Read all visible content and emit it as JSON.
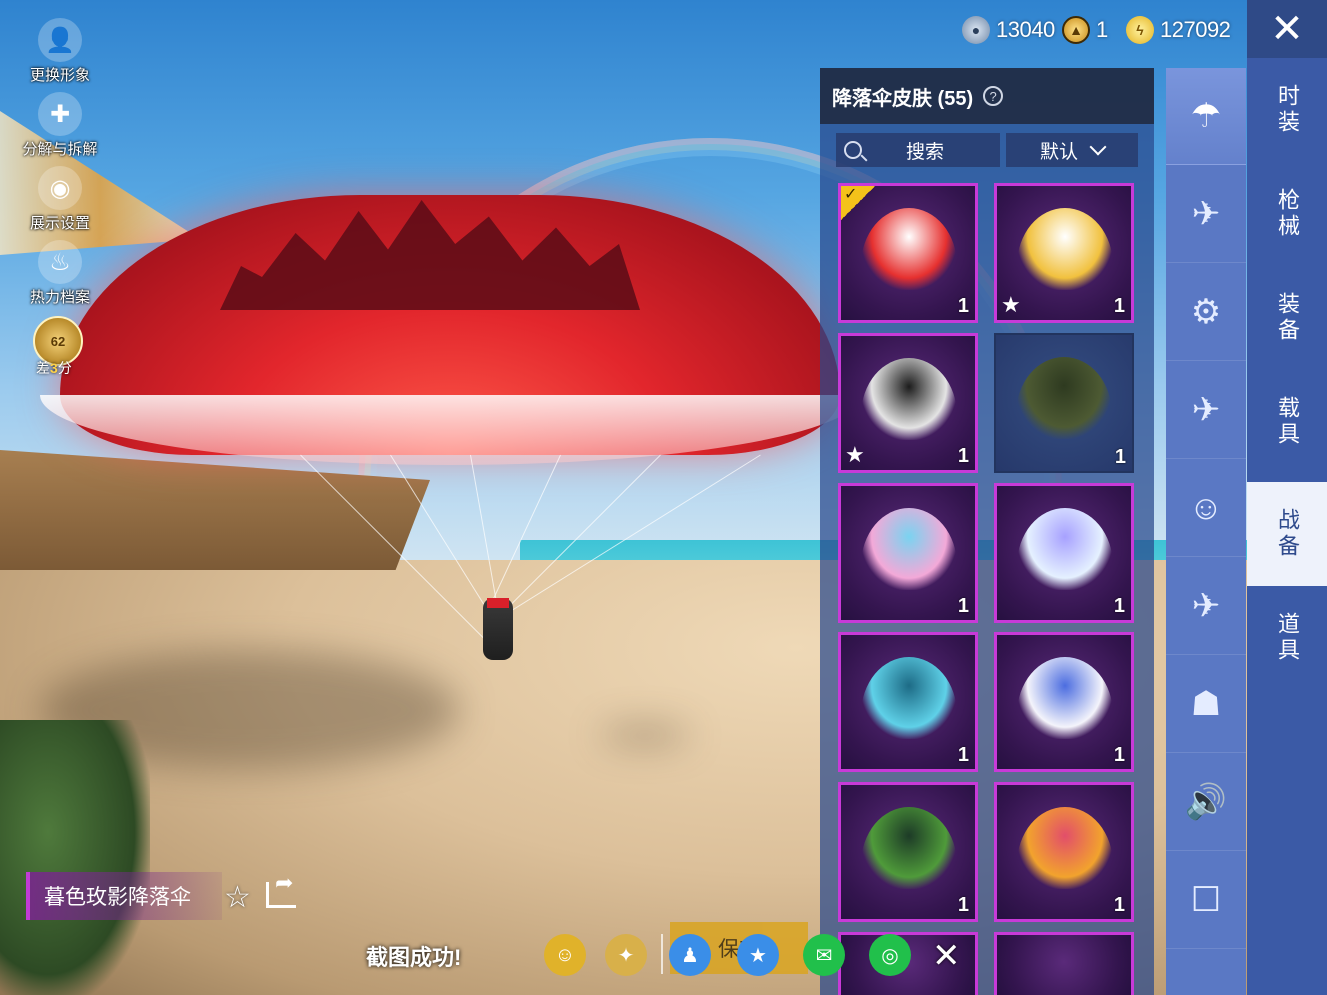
{
  "side_menu": {
    "change_avatar": "更换形象",
    "decompose": "分解与拆解",
    "display_settings": "展示设置",
    "heat_profile": "热力档案",
    "rank_level": "62",
    "rank_prefix": "差",
    "rank_points": "3",
    "rank_suffix": "分"
  },
  "currency": [
    {
      "icon": "silver-coin-icon",
      "value": "13040"
    },
    {
      "icon": "gold-medal-icon",
      "value": "1"
    },
    {
      "icon": "lightning-coin-icon",
      "value": "127092"
    }
  ],
  "categories": [
    {
      "label": "时装",
      "active": false
    },
    {
      "label": "枪械",
      "active": false
    },
    {
      "label": "装备",
      "active": false
    },
    {
      "label": "载具",
      "active": false
    },
    {
      "label": "战备",
      "active": true
    },
    {
      "label": "道具",
      "active": false
    }
  ],
  "subcategories": [
    {
      "icon": "parachute-icon",
      "active": true
    },
    {
      "icon": "skydiver-icon",
      "active": false
    },
    {
      "icon": "drone-icon",
      "active": false
    },
    {
      "icon": "airplane-icon",
      "active": false
    },
    {
      "icon": "emote-icon",
      "active": false
    },
    {
      "icon": "aircraft-icon",
      "active": false
    },
    {
      "icon": "robot-icon",
      "active": false
    },
    {
      "icon": "speaker-icon",
      "active": false
    },
    {
      "icon": "chat-icon",
      "active": false
    }
  ],
  "panel": {
    "title": "降落伞皮肤 (55)",
    "search_label": "搜索",
    "sort_label": "默认"
  },
  "items": [
    {
      "name": "red-castle-parachute",
      "count": "1",
      "equipped": true,
      "starred": false,
      "colors": [
        "#e6302f",
        "#ffffff"
      ]
    },
    {
      "name": "red-panda-parachute",
      "count": "1",
      "equipped": false,
      "starred": true,
      "colors": [
        "#f1c13e",
        "#ffffff"
      ]
    },
    {
      "name": "anime-girl-parachute",
      "count": "1",
      "equipped": false,
      "starred": true,
      "colors": [
        "#e4e4e4",
        "#1c1c1c"
      ]
    },
    {
      "name": "olive-parachute",
      "count": "1",
      "equipped": false,
      "starred": false,
      "plain": true,
      "colors": [
        "#4d5a33",
        "#2e3a20"
      ]
    },
    {
      "name": "pink-pattern-parachute",
      "count": "1",
      "equipped": false,
      "starred": false,
      "colors": [
        "#f3a9d8",
        "#7ad3f0"
      ]
    },
    {
      "name": "crystal-parachute",
      "count": "1",
      "equipped": false,
      "starred": false,
      "colors": [
        "#e5f1ff",
        "#a7a1ff"
      ]
    },
    {
      "name": "cyan-pattern-parachute",
      "count": "1",
      "equipped": false,
      "starred": false,
      "colors": [
        "#5fd1e8",
        "#1d6b86"
      ]
    },
    {
      "name": "white-tech-parachute",
      "count": "1",
      "equipped": false,
      "starred": false,
      "colors": [
        "#f4f4fb",
        "#4c6de0"
      ]
    },
    {
      "name": "green-tech-parachute",
      "count": "1",
      "equipped": false,
      "starred": false,
      "colors": [
        "#4f9b3a",
        "#1d3b27"
      ]
    },
    {
      "name": "colorful-cube-parachute",
      "count": "1",
      "equipped": false,
      "starred": false,
      "colors": [
        "#f2a32d",
        "#e24e6a"
      ]
    }
  ],
  "selected_item_name": "暮色玫影降落伞",
  "toast": "截图成功!",
  "share_bar": {
    "save_label": "保存",
    "buttons": [
      {
        "icon": "avatar-share-icon",
        "color": "#e0b22a"
      },
      {
        "icon": "game-logo-icon",
        "color": "#d8b04a"
      },
      {
        "icon": "qq-icon",
        "color": "#3a8ee8"
      },
      {
        "icon": "qzone-icon",
        "color": "#3a8ee8"
      },
      {
        "icon": "wechat-icon",
        "color": "#21c04b"
      },
      {
        "icon": "moments-icon",
        "color": "#21c04b"
      }
    ]
  }
}
